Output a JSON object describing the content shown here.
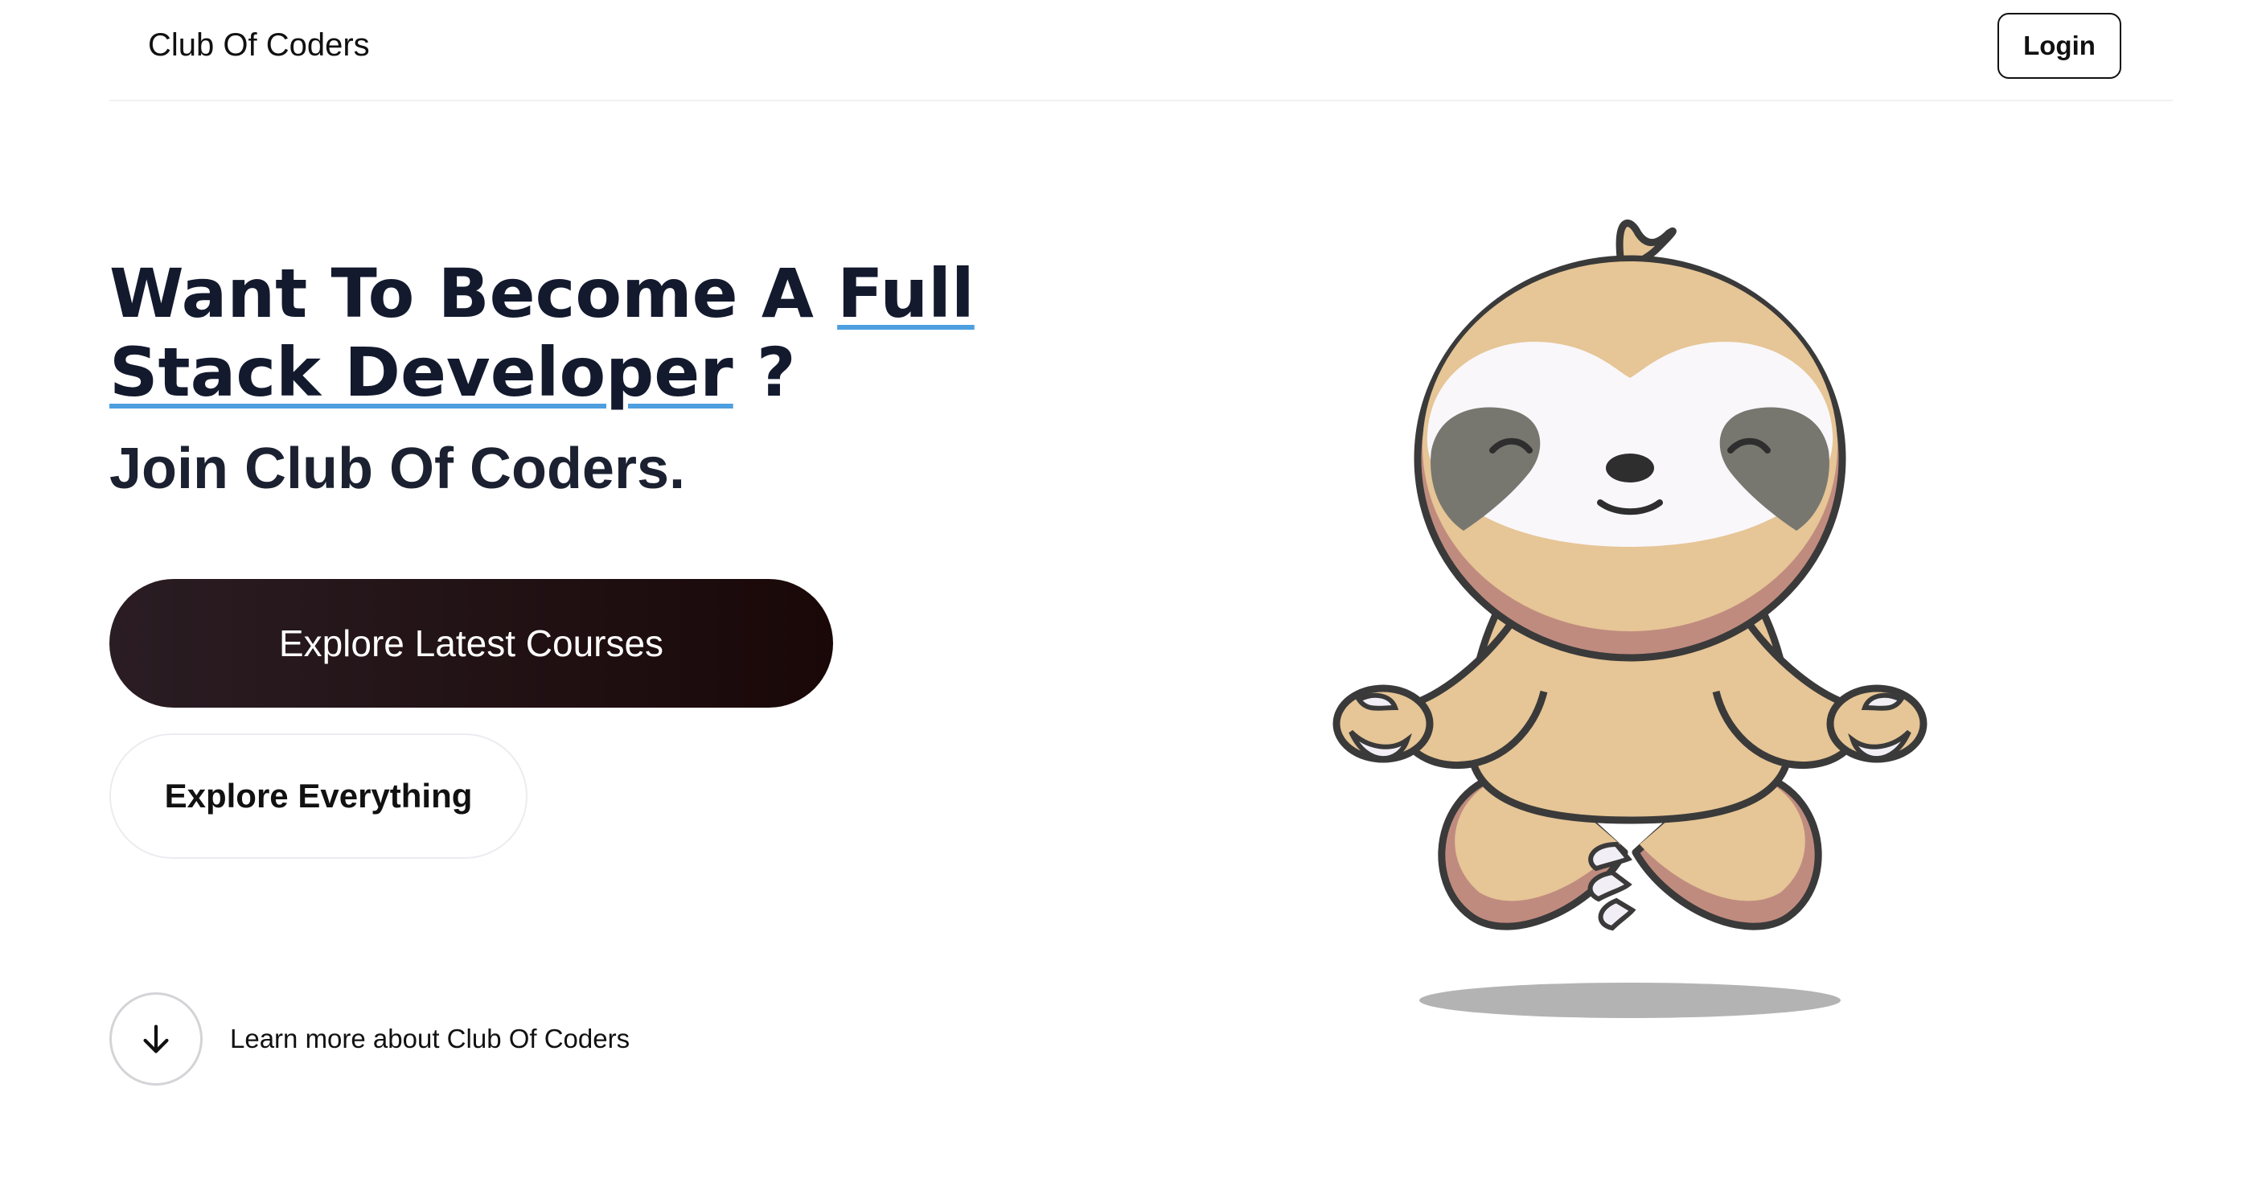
{
  "navbar": {
    "brand": "Club Of Coders",
    "login_label": "Login"
  },
  "hero": {
    "title_part1": "Want To Become A ",
    "title_highlight": "Full Stack Developer",
    "title_part2": " ?",
    "subtitle": "Join Club Of Coders.",
    "primary_button": "Explore Latest Courses",
    "secondary_button": "Explore Everything",
    "learn_more": "Learn more about Club Of Coders"
  },
  "icons": {
    "learn_more_icon": "arrow-down-icon",
    "illustration": "meditating-sloth-illustration"
  },
  "colors": {
    "underline_accent": "#4e9fe0",
    "primary_button_bg": "#1f1217",
    "sloth_fur": "#e6c596",
    "sloth_shadow_fur": "#c08b7f"
  }
}
